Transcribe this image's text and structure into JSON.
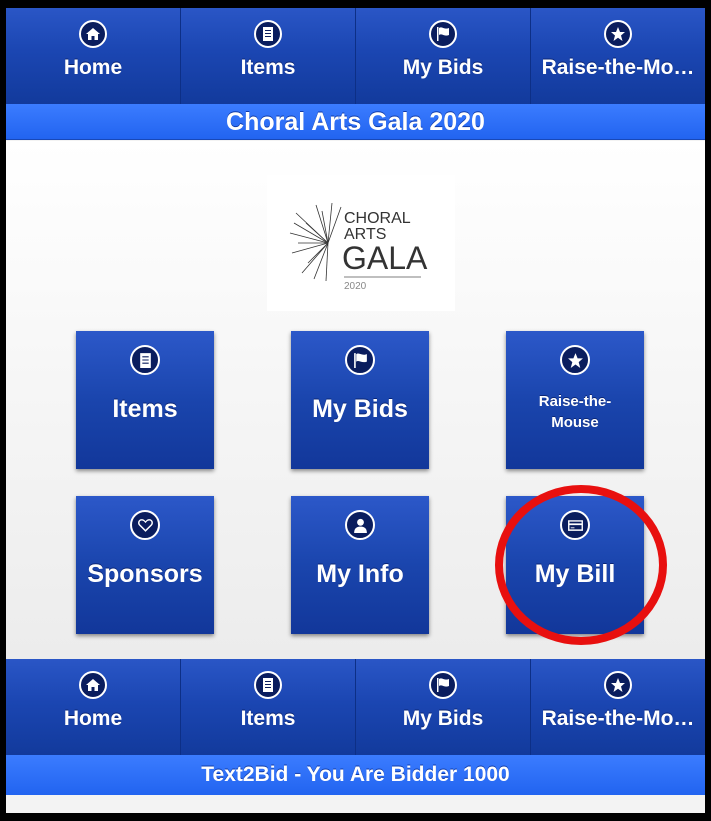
{
  "nav": [
    {
      "label": "Home",
      "icon": "home-icon"
    },
    {
      "label": "Items",
      "icon": "document-icon"
    },
    {
      "label": "My Bids",
      "icon": "flag-icon"
    },
    {
      "label": "Raise-the-Mo…",
      "icon": "star-icon"
    }
  ],
  "title": "Choral Arts Gala 2020",
  "logo": {
    "line1": "CHORAL",
    "line2": "ARTS",
    "line3": "GALA",
    "year": "2020"
  },
  "tiles": [
    {
      "label": "Items",
      "icon": "document-icon"
    },
    {
      "label": "My Bids",
      "icon": "flag-icon"
    },
    {
      "label_line1": "Raise-the-",
      "label_line2": "Mouse",
      "icon": "star-icon"
    },
    {
      "label": "Sponsors",
      "icon": "heart-icon"
    },
    {
      "label": "My Info",
      "icon": "person-icon"
    },
    {
      "label": "My Bill",
      "icon": "credit-card-icon"
    }
  ],
  "footer": "Text2Bid - You Are Bidder 1000",
  "colors": {
    "nav": "#1b46b2",
    "title_bar": "#2a6cf5",
    "highlight": "#e8100f"
  }
}
